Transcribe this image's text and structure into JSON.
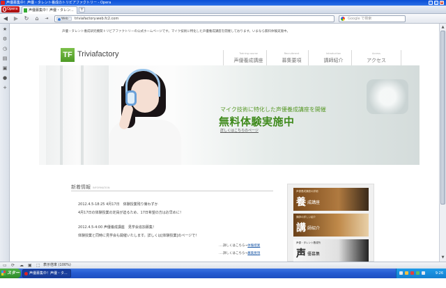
{
  "window": {
    "title": "声優募集中！声優・タレント養成のトリビアファクトリー - Opera",
    "controls": {
      "minimize": "_",
      "maximize": "□",
      "close": "×"
    }
  },
  "tabs": [
    {
      "label": "Opera",
      "active": false
    },
    {
      "label": "声優募集中！声優・タレン...",
      "active": true
    }
  ],
  "new_tab_label": "+",
  "nav": {
    "back": "◀",
    "forward": "▶",
    "reload": "↻",
    "home": "⌂",
    "web_badge": "Web",
    "url": "triviafactory.web.fc2.com",
    "search_placeholder": "Google で検索"
  },
  "side_panel_icons": [
    "star-icon",
    "gear-icon",
    "clock-icon",
    "notes-icon",
    "chat-icon",
    "stop-icon",
    "plus-icon"
  ],
  "page": {
    "notice": "声優・タレント養成研究機関トリビアファクトリーの公式ホームページです。マイク技術に特化した声優養成講座を開催しております。いまなら無料体験実施中。",
    "logo": {
      "mark": "TF",
      "text": "Triviafactory"
    },
    "gnav": [
      {
        "en": "Training course",
        "jp": "声優養成講座"
      },
      {
        "en": "Recruitment",
        "jp": "募集要項"
      },
      {
        "en": "Introduction",
        "jp": "講師紹介"
      },
      {
        "en": "Access",
        "jp": "アクセス"
      }
    ],
    "hero": {
      "tagline": "マイク技術に特化した声優養成講座を開催",
      "heading": "無料体験実施中",
      "detail_link": "詳しくはこちらのページ"
    },
    "news": {
      "title": "新着情報",
      "title_en": "INFORMATION",
      "items": [
        {
          "title": "2012.4.5-18:25 4月17日　体験授業残り席わずか",
          "body": "4月17日の体験授業の定員が迫るため、17日希望の方はお早めに！"
        },
        {
          "title": "2012.4.5-4:00 声優養成講座　見学会追加募集！",
          "body": "体験授業と同時に見学会も開催いたします。詳しくは[体験授業]のページで！"
        }
      ],
      "more_links": [
        {
          "prefix": "‥‥詳しくはこちら→",
          "link": "体験授業"
        },
        {
          "prefix": "‥‥詳しくはこちら→",
          "link": "募集要項"
        }
      ]
    },
    "banners": [
      {
        "caption": "声優養成講座の詳細",
        "big": "養",
        "sub": "成講座",
        "color": "#7a4a1c"
      },
      {
        "caption": "講師の詳しい紹介",
        "big": "講",
        "sub": "師紹介",
        "color": "#6a4018"
      },
      {
        "caption": "声優・タレント養成所",
        "big": "声",
        "sub": "優募集",
        "color": "#222222"
      }
    ]
  },
  "status": {
    "zoom_label": "表示倍率 (100%)"
  },
  "taskbar": {
    "start": "スタート",
    "item": "声優募集中！声優・タ...",
    "clock": "9:26"
  }
}
